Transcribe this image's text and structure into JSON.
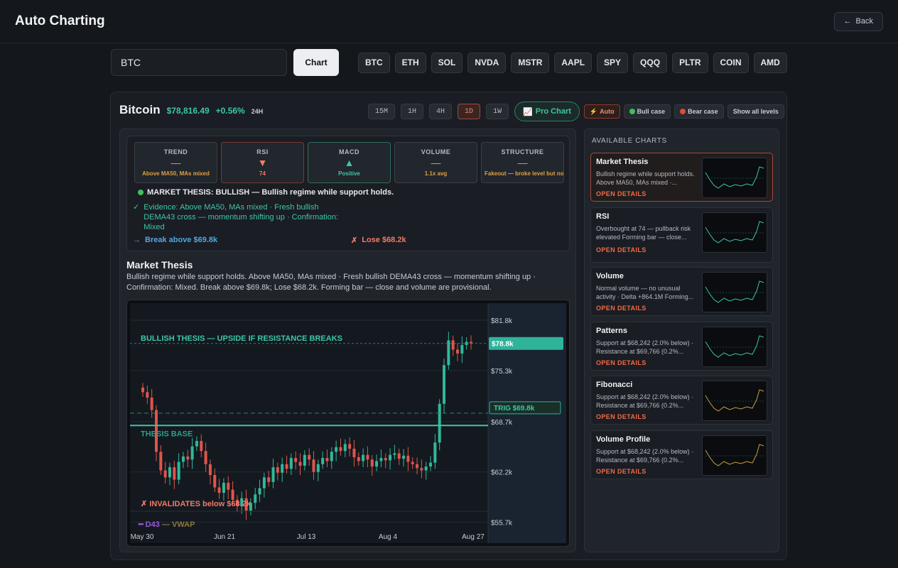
{
  "app": {
    "title": "Auto Charting",
    "back_label": "Back"
  },
  "search": {
    "value": "BTC",
    "chart_label": "Chart"
  },
  "tickers": [
    "BTC",
    "ETH",
    "SOL",
    "NVDA",
    "MSTR",
    "AAPL",
    "SPY",
    "QQQ",
    "PLTR",
    "COIN",
    "AMD"
  ],
  "asset": {
    "name": "Bitcoin",
    "price": "$78,816.49",
    "change": "+0.56%",
    "range": "24H"
  },
  "timeframes": [
    "15M",
    "1H",
    "4H",
    "1D",
    "1W"
  ],
  "active_timeframe": "1D",
  "toolbar": {
    "pro_chart": "Pro Chart",
    "auto": "Auto",
    "bull": "Bull case",
    "bear": "Bear case",
    "show_levels": "Show all levels"
  },
  "metrics": [
    {
      "label": "TREND",
      "symbol": "—",
      "value": "Above MA50, MAs mixed",
      "color": "#e0a040"
    },
    {
      "label": "RSI",
      "symbol": "▼",
      "value": "74",
      "color": "#f07a6a"
    },
    {
      "label": "MACD",
      "symbol": "▲",
      "value": "Positive",
      "color": "#3ec6a8"
    },
    {
      "label": "VOLUME",
      "symbol": "—",
      "value": "1.1x avg",
      "color": "#e0a040"
    },
    {
      "label": "STRUCTURE",
      "symbol": "—",
      "value": "Fakeout — broke level but no follow-through",
      "color": "#e0a040"
    }
  ],
  "thesis": {
    "headline": "MARKET THESIS: BULLISH — Bullish regime while support holds.",
    "evidence": "Evidence: Above MA50, MAs mixed · Fresh bullish DEMA43 cross — momentum shifting up · Confirmation: Mixed",
    "break": "Break above $69.8k",
    "lose": "Lose $68.2k"
  },
  "section": {
    "title": "Market Thesis",
    "desc": "Bullish regime while support holds. Above MA50, MAs mixed · Fresh bullish DEMA43 cross — momentum shifting up · Confirmation: Mixed. Break above $69.8k; Lose $68.2k. Forming bar — close and volume are provisional."
  },
  "chart": {
    "banner": "BULLISH THESIS — UPSIDE IF RESISTANCE BREAKS",
    "base_label": "THESIS BASE",
    "invalidate": "✗ INVALIDATES below $68.2k",
    "legend_d43": "D43",
    "legend_vwap": "VWAP",
    "price_tag": "$78.8k",
    "trigger_tag": "TRIG $69.8k",
    "y_ticks": [
      "$81.8k",
      "$75.3k",
      "$68.7k",
      "$62.2k",
      "$55.7k"
    ],
    "x_ticks": [
      "May 30",
      "Jun 21",
      "Jul 13",
      "Aug 4",
      "Aug 27"
    ]
  },
  "chart_data": {
    "type": "candlestick",
    "title": "BULLISH THESIS — UPSIDE IF RESISTANCE BREAKS",
    "x_start": "May 30",
    "x_end": "Aug 27",
    "ylim": [
      53000,
      84000
    ],
    "levels": {
      "current": 78800,
      "trigger": 69800,
      "invalidation": 68200,
      "base": 68200
    },
    "closes": [
      72500,
      71800,
      70200,
      64800,
      62400,
      61500,
      62800,
      61200,
      63500,
      64200,
      63800,
      65500,
      66200,
      64900,
      63200,
      61800,
      60200,
      59500,
      60800,
      59900,
      58600,
      57800,
      58800,
      57200,
      58200,
      59300,
      60100,
      61500,
      60900,
      62800,
      62100,
      63200,
      62600,
      64000,
      63500,
      63000,
      64400,
      63800,
      62200,
      63200,
      64000,
      63600,
      64800,
      65400,
      64900,
      65800,
      65200,
      64100,
      63600,
      64400,
      63800,
      62900,
      63600,
      64000,
      63700,
      64400,
      64600,
      63900,
      64300,
      63500,
      63200,
      62700,
      62400,
      62900,
      63400,
      66000,
      71000,
      76000,
      79200,
      78000,
      77500,
      78600,
      79000,
      78800
    ]
  },
  "side": {
    "title": "AVAILABLE CHARTS",
    "open_label": "OPEN DETAILS",
    "cards": [
      {
        "title": "Market Thesis",
        "desc": "Bullish regime while support holds. Above MA50, MAs mixed ·..."
      },
      {
        "title": "RSI",
        "desc": "Overbought at 74 — pullback risk elevated Forming bar — close..."
      },
      {
        "title": "Volume",
        "desc": "Normal volume — no unusual activity · Delta +864.1M Forming..."
      },
      {
        "title": "Patterns",
        "desc": "Support at $68,242 (2.0% below) · Resistance at $69,766 (0.2%..."
      },
      {
        "title": "Fibonacci",
        "desc": "Support at $68,242 (2.0% below) · Resistance at $69,766 (0.2%..."
      },
      {
        "title": "Volume Profile",
        "desc": "Support at $68,242 (2.0% below) · Resistance at $69,766 (0.2%..."
      }
    ]
  }
}
